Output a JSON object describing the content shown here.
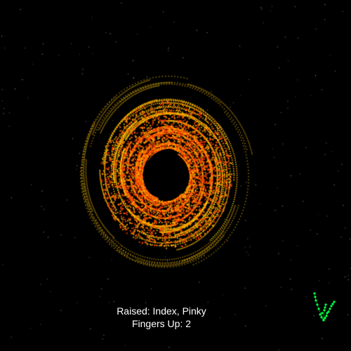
{
  "hud": {
    "raised_label": "Raised: Index, Pinky",
    "fingers_label": "Fingers Up: 2"
  },
  "visual": {
    "background_color": "#000000",
    "star_color": "#ffffff",
    "galaxy_colors": [
      "#ffa500",
      "#ffd000",
      "#ff4500",
      "#e8c010"
    ],
    "hand_skeleton_color": "#00ff40",
    "hand_landmark_color": "#00ff40"
  }
}
